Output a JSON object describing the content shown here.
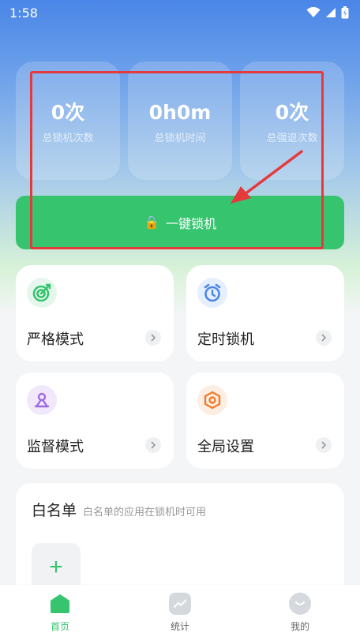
{
  "status": {
    "time": "1:58"
  },
  "stats": [
    {
      "value": "0次",
      "label": "总锁机次数"
    },
    {
      "value": "0h0m",
      "label": "总锁机时间"
    },
    {
      "value": "0次",
      "label": "总强退次数"
    }
  ],
  "lock_button": {
    "label": "一键锁机",
    "emoji": "🔒"
  },
  "features": [
    {
      "title": "严格模式",
      "icon": "target-icon"
    },
    {
      "title": "定时锁机",
      "icon": "alarm-clock-icon"
    },
    {
      "title": "监督模式",
      "icon": "person-icon"
    },
    {
      "title": "全局设置",
      "icon": "hex-nut-icon"
    }
  ],
  "whitelist": {
    "title": "白名单",
    "subtitle": "白名单的应用在锁机时可用",
    "add": "+"
  },
  "tabs": [
    {
      "label": "首页",
      "icon": "home-icon",
      "active": true
    },
    {
      "label": "统计",
      "icon": "chart-icon",
      "active": false
    },
    {
      "label": "我的",
      "icon": "profile-icon",
      "active": false
    }
  ],
  "colors": {
    "accent_green": "#36c46e",
    "highlight_red": "#e5393b"
  }
}
